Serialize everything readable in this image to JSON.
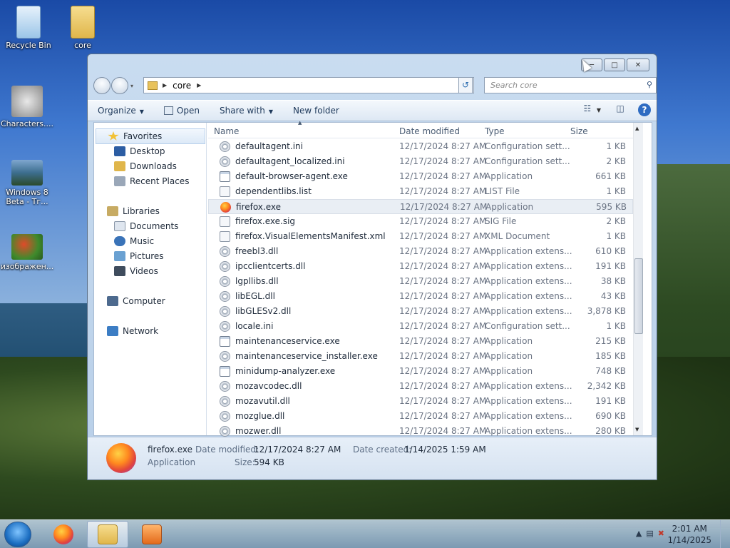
{
  "desktop": {
    "icons": [
      {
        "label": "Recycle Bin",
        "icon": "recycle-bin-icon",
        "color": "#9cc6e8"
      },
      {
        "label": "core",
        "icon": "folder-icon",
        "color": "#e8c25c"
      },
      {
        "label": "Characters....",
        "icon": "characters-icon",
        "color": "#9a9a9a"
      },
      {
        "label": "Windows 8 Beta - Тг...",
        "icon": "image-icon",
        "color": "#3d6e8f"
      },
      {
        "label": "изображен...",
        "icon": "image-icon",
        "color": "#3f8a2c"
      }
    ]
  },
  "window": {
    "address": {
      "segment": "core"
    },
    "search": {
      "placeholder": "Search core"
    },
    "toolbar": {
      "organize": "Organize",
      "open": "Open",
      "share_with": "Share with",
      "new_folder": "New folder"
    },
    "nav": {
      "favorites": "Favorites",
      "desktop": "Desktop",
      "downloads": "Downloads",
      "recent_places": "Recent Places",
      "libraries": "Libraries",
      "documents": "Documents",
      "music": "Music",
      "pictures": "Pictures",
      "videos": "Videos",
      "computer": "Computer",
      "network": "Network"
    },
    "columns": {
      "name": "Name",
      "date": "Date modified",
      "type": "Type",
      "size": "Size"
    },
    "files": [
      {
        "name": "defaultagent.ini",
        "date": "12/17/2024 8:27 AM",
        "type": "Configuration sett...",
        "size": "1 KB",
        "icon": "ini"
      },
      {
        "name": "defaultagent_localized.ini",
        "date": "12/17/2024 8:27 AM",
        "type": "Configuration sett...",
        "size": "2 KB",
        "icon": "ini"
      },
      {
        "name": "default-browser-agent.exe",
        "date": "12/17/2024 8:27 AM",
        "type": "Application",
        "size": "661 KB",
        "icon": "exe"
      },
      {
        "name": "dependentlibs.list",
        "date": "12/17/2024 8:27 AM",
        "type": "LIST File",
        "size": "1 KB",
        "icon": "file"
      },
      {
        "name": "firefox.exe",
        "date": "12/17/2024 8:27 AM",
        "type": "Application",
        "size": "595 KB",
        "icon": "ff"
      },
      {
        "name": "firefox.exe.sig",
        "date": "12/17/2024 8:27 AM",
        "type": "SIG File",
        "size": "2 KB",
        "icon": "file"
      },
      {
        "name": "firefox.VisualElementsManifest.xml",
        "date": "12/17/2024 8:27 AM",
        "type": "XML Document",
        "size": "1 KB",
        "icon": "file"
      },
      {
        "name": "freebl3.dll",
        "date": "12/17/2024 8:27 AM",
        "type": "Application extens...",
        "size": "610 KB",
        "icon": "gear"
      },
      {
        "name": "ipcclientcerts.dll",
        "date": "12/17/2024 8:27 AM",
        "type": "Application extens...",
        "size": "191 KB",
        "icon": "gear"
      },
      {
        "name": "lgpllibs.dll",
        "date": "12/17/2024 8:27 AM",
        "type": "Application extens...",
        "size": "38 KB",
        "icon": "gear"
      },
      {
        "name": "libEGL.dll",
        "date": "12/17/2024 8:27 AM",
        "type": "Application extens...",
        "size": "43 KB",
        "icon": "gear"
      },
      {
        "name": "libGLESv2.dll",
        "date": "12/17/2024 8:27 AM",
        "type": "Application extens...",
        "size": "3,878 KB",
        "icon": "gear"
      },
      {
        "name": "locale.ini",
        "date": "12/17/2024 8:27 AM",
        "type": "Configuration sett...",
        "size": "1 KB",
        "icon": "ini"
      },
      {
        "name": "maintenanceservice.exe",
        "date": "12/17/2024 8:27 AM",
        "type": "Application",
        "size": "215 KB",
        "icon": "exe"
      },
      {
        "name": "maintenanceservice_installer.exe",
        "date": "12/17/2024 8:27 AM",
        "type": "Application",
        "size": "185 KB",
        "icon": "gear"
      },
      {
        "name": "minidump-analyzer.exe",
        "date": "12/17/2024 8:27 AM",
        "type": "Application",
        "size": "748 KB",
        "icon": "exe"
      },
      {
        "name": "mozavcodec.dll",
        "date": "12/17/2024 8:27 AM",
        "type": "Application extens...",
        "size": "2,342 KB",
        "icon": "gear"
      },
      {
        "name": "mozavutil.dll",
        "date": "12/17/2024 8:27 AM",
        "type": "Application extens...",
        "size": "191 KB",
        "icon": "gear"
      },
      {
        "name": "mozglue.dll",
        "date": "12/17/2024 8:27 AM",
        "type": "Application extens...",
        "size": "690 KB",
        "icon": "gear"
      },
      {
        "name": "mozwer.dll",
        "date": "12/17/2024 8:27 AM",
        "type": "Application extens...",
        "size": "280 KB",
        "icon": "gear"
      }
    ],
    "selected_index": 4,
    "details": {
      "name": "firefox.exe",
      "type": "Application",
      "date_modified_label": "Date modified:",
      "date_modified": "12/17/2024 8:27 AM",
      "date_created_label": "Date created:",
      "date_created": "1/14/2025 1:59 AM",
      "size_label": "Size:",
      "size": "594 KB"
    }
  },
  "taskbar": {
    "time": "2:01 AM",
    "date": "1/14/2025"
  }
}
